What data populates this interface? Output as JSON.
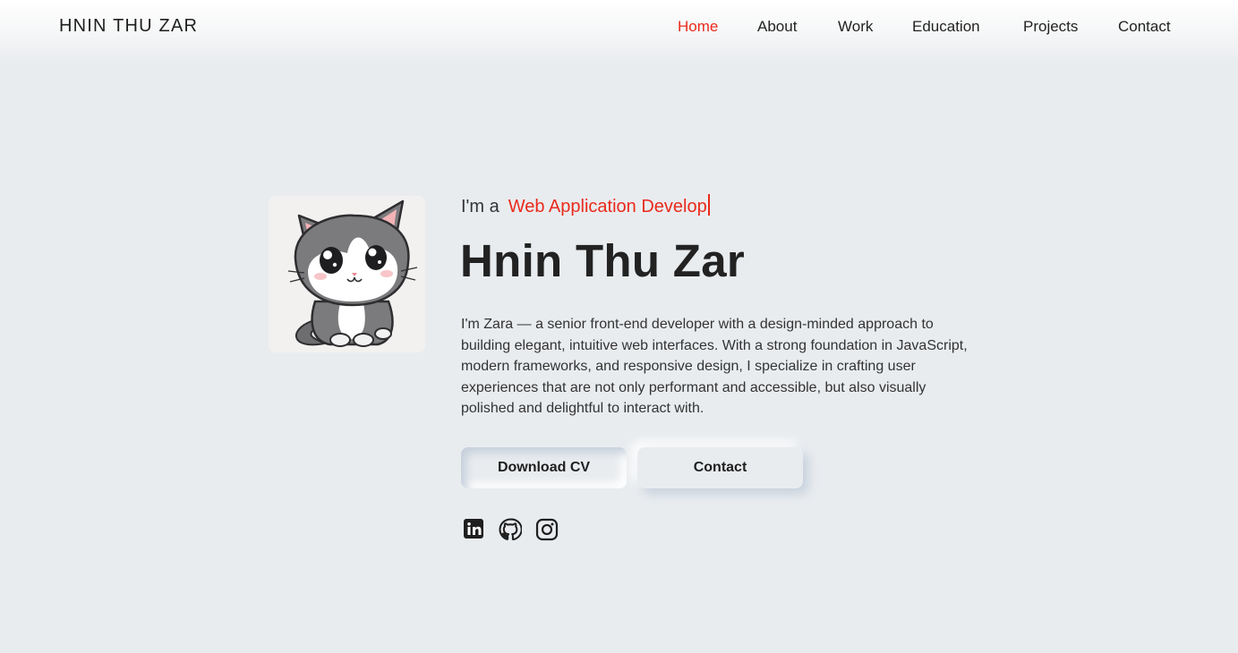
{
  "header": {
    "brand": "HNIN THU ZAR",
    "nav": [
      {
        "label": "Home",
        "active": true
      },
      {
        "label": "About",
        "active": false
      },
      {
        "label": "Work",
        "active": false
      },
      {
        "label": "Education",
        "active": false
      },
      {
        "label": "Projects",
        "active": false
      },
      {
        "label": "Contact",
        "active": false
      }
    ]
  },
  "hero": {
    "intro_prefix": "I'm a",
    "typed_role": "Web Application Develop",
    "name": "Hnin Thu Zar",
    "bio": "I'm Zara — a senior front-end developer with a design-minded approach to building elegant, intuitive web interfaces. With a strong foundation in JavaScript, modern frameworks, and responsive design, I specialize in crafting user experiences that are not only performant and accessible, but also visually polished and delightful to interact with.",
    "buttons": {
      "download_cv": "Download CV",
      "contact": "Contact"
    },
    "socials": [
      "linkedin-icon",
      "github-icon",
      "instagram-icon"
    ],
    "avatar": "cat-avatar"
  },
  "colors": {
    "accent": "#ea2a1c",
    "background": "#e9ecef",
    "text": "#222222"
  }
}
